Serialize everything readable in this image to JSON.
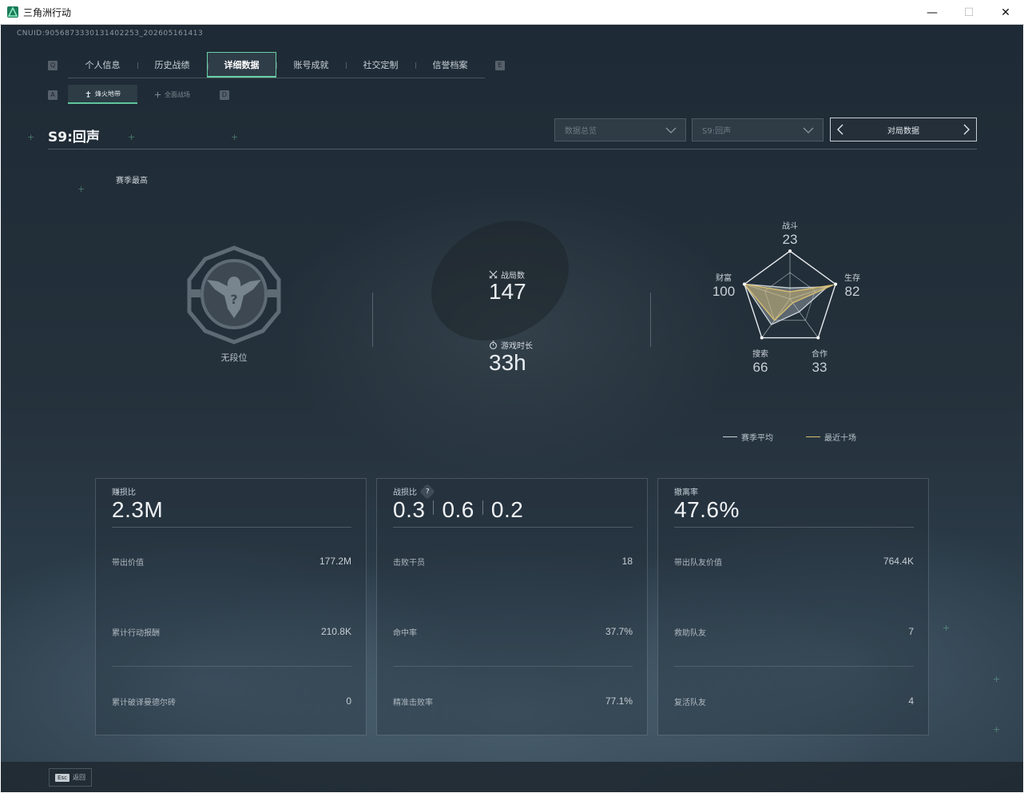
{
  "window": {
    "title": "三角洲行动",
    "minimize": "—",
    "maximize": "☐",
    "close": "✕"
  },
  "cnuid": "CNUID:9056873330131402253_202605161413",
  "tabs": {
    "left_key": "Q",
    "right_key": "E",
    "items": [
      {
        "label": "个人信息"
      },
      {
        "label": "历史战绩"
      },
      {
        "label": "详细数据",
        "active": true
      },
      {
        "label": "账号成就"
      },
      {
        "label": "社交定制"
      },
      {
        "label": "信誉档案"
      }
    ]
  },
  "subtabs": {
    "left_key": "A",
    "right_key": "D",
    "items": [
      {
        "label": "烽火地带",
        "active": true
      },
      {
        "label": "全面战场"
      }
    ]
  },
  "season": {
    "title": "S9:回声",
    "dropdown1": "数据总览",
    "dropdown2": "S9:回声",
    "pager_label": "对局数据"
  },
  "summary": {
    "best_label": "赛季最高",
    "rank_label": "无段位",
    "matches_label": "战局数",
    "matches_value": "147",
    "time_label": "游戏时长",
    "time_value": "33h"
  },
  "radar": {
    "axes": [
      {
        "label": "战斗",
        "value": "23"
      },
      {
        "label": "生存",
        "value": "82"
      },
      {
        "label": "合作",
        "value": "33"
      },
      {
        "label": "搜索",
        "value": "66"
      },
      {
        "label": "财富",
        "value": "100"
      }
    ],
    "season_avg": [
      23,
      82,
      33,
      66,
      100
    ],
    "recent10": [
      15,
      95,
      10,
      55,
      100
    ],
    "legend": {
      "season_avg": "赛季平均",
      "recent10": "最近十场"
    },
    "colors": {
      "season_avg": "#c8d0d6",
      "recent10": "#d6bd72"
    }
  },
  "cards": [
    {
      "label": "赚损比",
      "big": "2.3M",
      "rows": [
        {
          "k": "带出价值",
          "v": "177.2M"
        },
        {
          "k": "累计行动报酬",
          "v": "210.8K"
        },
        {
          "k": "累计破译曼德尔砖",
          "v": "0"
        }
      ]
    },
    {
      "label": "战损比",
      "help": "?",
      "big_parts": [
        "0.3",
        "0.6",
        "0.2"
      ],
      "rows": [
        {
          "k": "击败干员",
          "v": "18"
        },
        {
          "k": "命中率",
          "v": "37.7%"
        },
        {
          "k": "精准击败率",
          "v": "77.1%"
        }
      ]
    },
    {
      "label": "撤离率",
      "big": "47.6%",
      "rows": [
        {
          "k": "带出队友价值",
          "v": "764.4K"
        },
        {
          "k": "救助队友",
          "v": "7"
        },
        {
          "k": "复活队友",
          "v": "4"
        }
      ]
    }
  ],
  "footer": {
    "esc_key": "Esc",
    "esc_label": "返回"
  },
  "colors": {
    "accent": "#6ad0a8",
    "gold": "#d6bd72"
  }
}
